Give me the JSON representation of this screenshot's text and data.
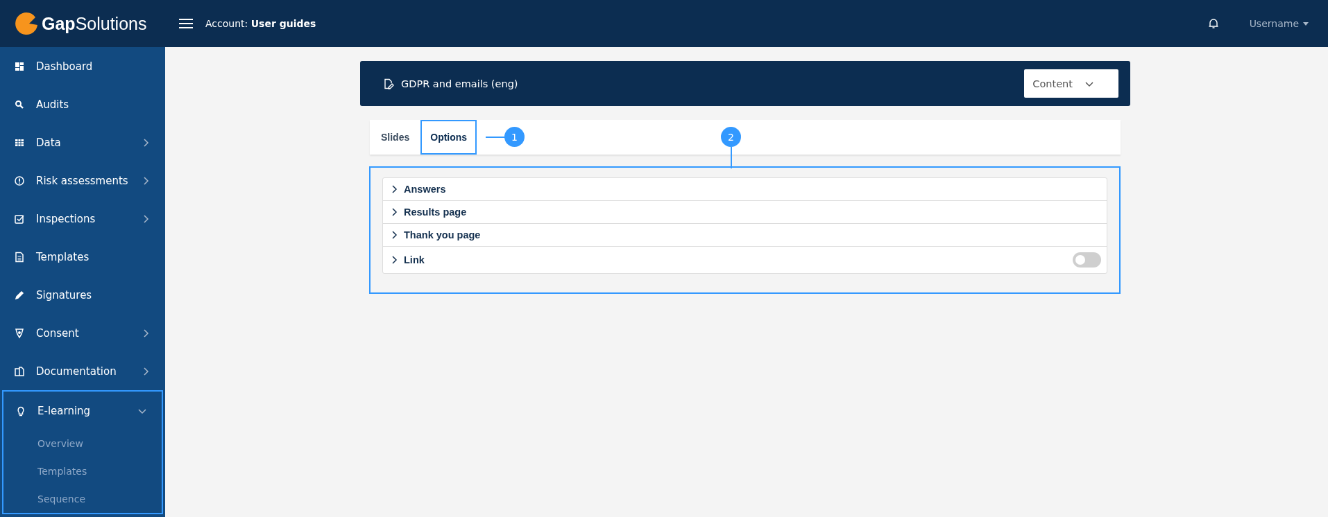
{
  "header": {
    "logo": "**Gap**Solutions",
    "account": "Account: **User guides**",
    "user": "Username"
  },
  "sidebar": {
    "items": [
      {
        "label": "Dashboard",
        "has_children": false
      },
      {
        "label": "Audits",
        "has_children": false
      },
      {
        "label": "Data",
        "has_children": true,
        "expanded": false
      },
      {
        "label": "Risk assessments",
        "has_children": true,
        "expanded": false
      },
      {
        "label": "Inspections",
        "has_children": true,
        "expanded": false
      },
      {
        "label": "Templates",
        "has_children": false
      },
      {
        "label": "Signatures",
        "has_children": false
      },
      {
        "label": "Consent",
        "has_children": true,
        "expanded": false
      },
      {
        "label": "Documentation",
        "has_children": true,
        "expanded": false
      },
      {
        "label": "E-learning",
        "has_children": true,
        "expanded": true,
        "highlighted": true,
        "children": [
          {
            "label": "Overview"
          },
          {
            "label": "Templates"
          },
          {
            "label": "Sequence"
          }
        ]
      }
    ]
  },
  "page": {
    "title": "GDPR and emails (eng)",
    "view_select": "Content"
  },
  "tabs": [
    {
      "label": "Slides",
      "selected": false,
      "highlighted": false
    },
    {
      "label": "Options",
      "selected": true,
      "highlighted": true
    }
  ],
  "options": {
    "highlighted": true,
    "rows": [
      {
        "label": "Answers",
        "kind": "plain"
      },
      {
        "label": "Results page",
        "kind": "plain"
      },
      {
        "label": "Thank you page",
        "kind": "plain"
      },
      {
        "label": "Link",
        "kind": "toggle",
        "on": false
      }
    ]
  },
  "annotations": [
    {
      "label": "1"
    },
    {
      "label": "2"
    }
  ]
}
